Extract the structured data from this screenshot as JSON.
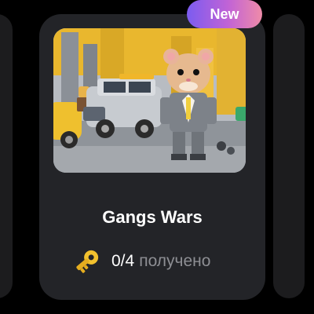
{
  "card": {
    "badge_label": "New",
    "title": "Gangs Wars",
    "progress_count": "0/4",
    "progress_status": "получено",
    "image_icon": "game-thumbnail-image",
    "key_icon": "key-icon"
  },
  "colors": {
    "card_background": "#232428",
    "page_background": "#000000",
    "badge_gradient": [
      "#7b5cf0",
      "#c163d6",
      "#ef8ba8"
    ],
    "title_text": "#ffffff",
    "muted_text": "#8d8e93"
  }
}
